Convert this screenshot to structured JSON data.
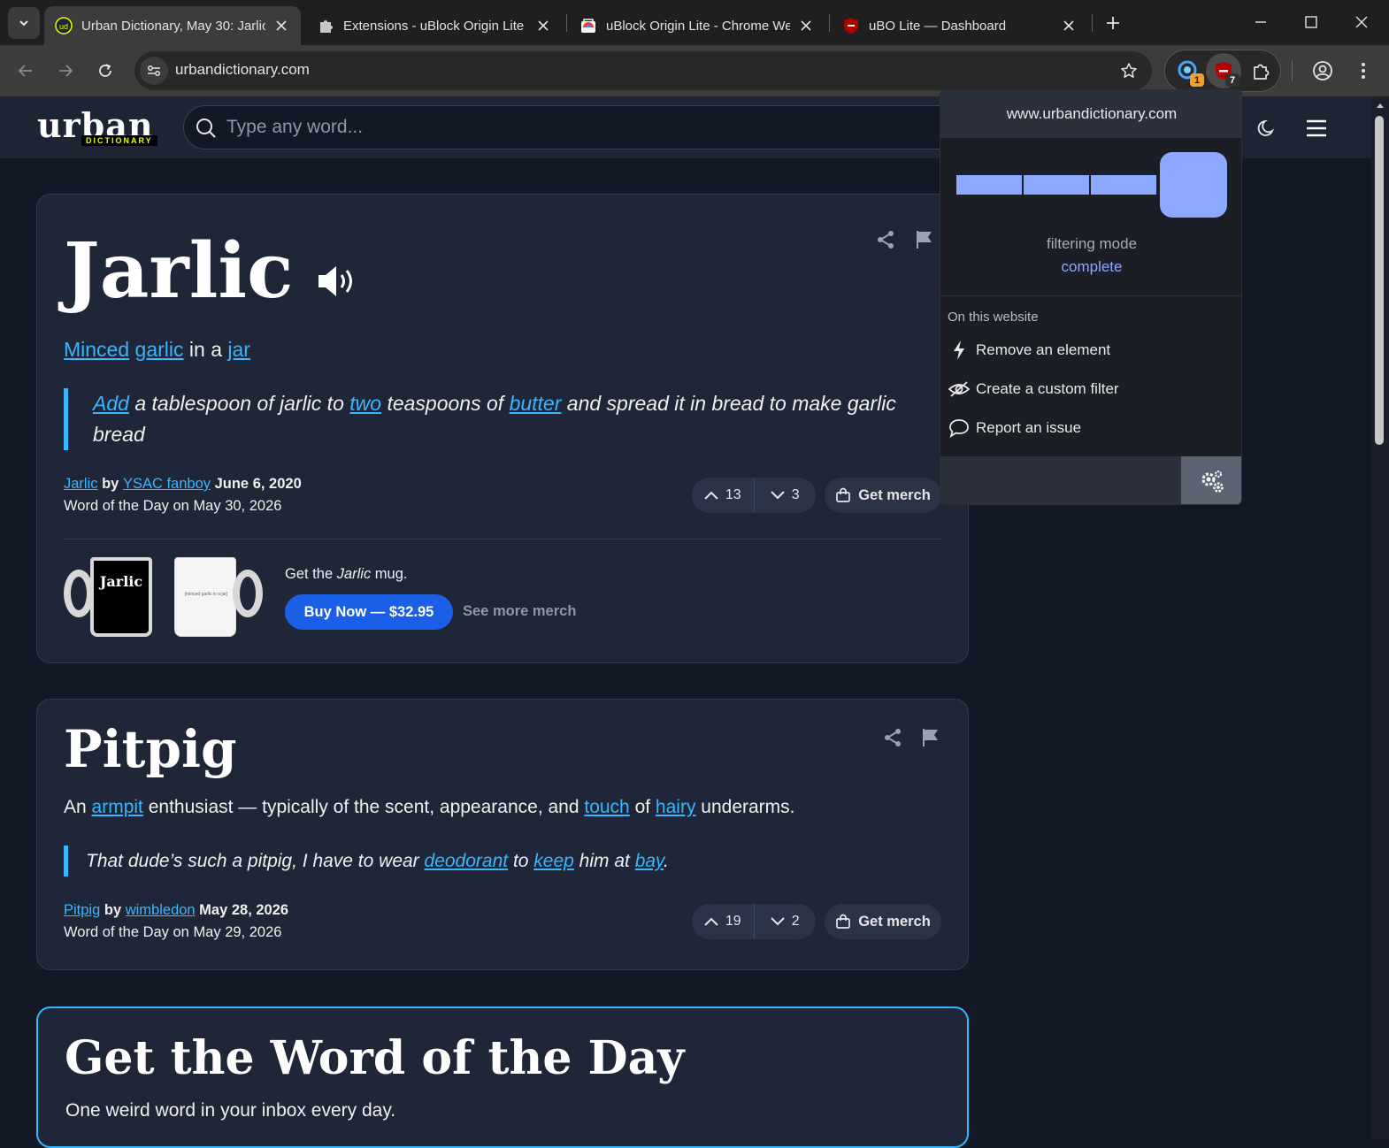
{
  "browser": {
    "tabs": [
      {
        "title": "Urban Dictionary, May 30: Jarlic",
        "favicon": "urban-dictionary-favicon"
      },
      {
        "title": "Extensions - uBlock Origin Lite",
        "favicon": "puzzle-favicon"
      },
      {
        "title": "uBlock Origin Lite - Chrome Web Store",
        "favicon": "chrome-web-store-favicon"
      },
      {
        "title": "uBO Lite — Dashboard",
        "favicon": "ubo-shield-favicon"
      }
    ],
    "url": "urbandictionary.com",
    "extensions": [
      {
        "icon": "vpn-extension-icon",
        "badge": "1",
        "badge_color": "#f0a030"
      },
      {
        "icon": "ubo-lite-icon",
        "badge": "7",
        "badge_color": "#303030"
      }
    ]
  },
  "site": {
    "logo_word": "urban",
    "logo_sub": "DICTIONARY",
    "search_placeholder": "Type any word..."
  },
  "entries": [
    {
      "word": "Jarlic",
      "definition": {
        "t1": "Minced",
        "t2": "garlic",
        "t3": " in a ",
        "t4": "jar"
      },
      "example": {
        "t1": "Add",
        "t2": " a tablespoon of jarlic to ",
        "t3": "two",
        "t4": " teaspoons of ",
        "t5": "butter",
        "t6": " and spread it in bread to make garlic bread"
      },
      "word_link": "Jarlic",
      "by": " by ",
      "author": "YSAC fanboy",
      "date": " June 6, 2020",
      "wotd": "Word of the Day on May 30, 2026",
      "upvotes": "13",
      "downvotes": "3",
      "merch_label": "Get merch",
      "merch_promo": {
        "prefix": "Get the ",
        "word": "Jarlic",
        "suffix": " mug.",
        "buy_label": "Buy Now — $32.95",
        "see_more": "See more merch",
        "mug_text": "Jarlic",
        "mug_back_text": "[minced garlic in a jar]"
      }
    },
    {
      "word": "Pitpig",
      "definition": {
        "t1": "An ",
        "t2": "armpit",
        "t3": " enthusiast — typically of the scent, appearance, and ",
        "t4": "touch",
        "t5": " of ",
        "t6": "hairy",
        "t7": " underarms."
      },
      "example": {
        "t1": "That dude’s such a pitpig, I have to wear ",
        "t2": "deodorant",
        "t3": " to ",
        "t4": "keep",
        "t5": " him at ",
        "t6": "bay",
        "t7": "."
      },
      "word_link": "Pitpig",
      "by": " by ",
      "author": "wimbledon",
      "date": " May 28, 2026",
      "wotd": "Word of the Day on May 29, 2026",
      "upvotes": "19",
      "downvotes": "2",
      "merch_label": "Get merch"
    }
  ],
  "wotd_signup": {
    "title": "Get the Word of the Day",
    "subtitle": "One weird word in your inbox every day."
  },
  "ubo_popup": {
    "hostname": "www.urbandictionary.com",
    "filtering_mode_label": "filtering mode",
    "filtering_mode_value": "complete",
    "section_label": "On this website",
    "items": [
      {
        "label": "Remove an element",
        "icon": "lightning-icon"
      },
      {
        "label": "Create a custom filter",
        "icon": "eye-slash-icon"
      },
      {
        "label": "Report an issue",
        "icon": "speech-bubble-icon"
      }
    ],
    "accent_color": "#8da8ff"
  }
}
